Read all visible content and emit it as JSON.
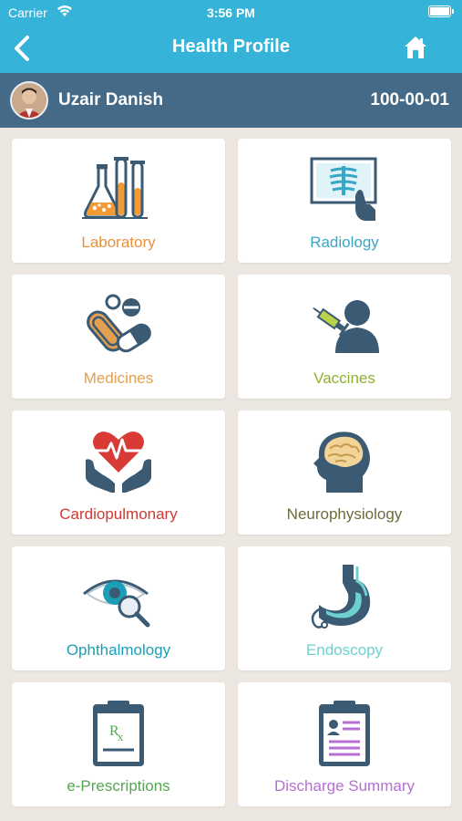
{
  "status_bar": {
    "carrier": "Carrier",
    "time": "3:56 PM"
  },
  "nav": {
    "title": "Health Profile",
    "back_icon": "chevron-left-icon",
    "home_icon": "home-icon"
  },
  "patient": {
    "name": "Uzair Danish",
    "id": "100-00-01"
  },
  "colors": {
    "header": "#36b3d8",
    "profile_bar": "#456a87",
    "background": "#ece8e1"
  },
  "categories": [
    {
      "label": "Laboratory",
      "color": "#e8913a",
      "icon": "lab-flasks-icon"
    },
    {
      "label": "Radiology",
      "color": "#3aa6c7",
      "icon": "xray-icon"
    },
    {
      "label": "Medicines",
      "color": "#e3a04f",
      "icon": "pills-icon"
    },
    {
      "label": "Vaccines",
      "color": "#8fb12e",
      "icon": "vaccine-icon"
    },
    {
      "label": "Cardiopulmonary",
      "color": "#d03a34",
      "icon": "heart-hands-icon"
    },
    {
      "label": "Neurophysiology",
      "color": "#6b6b3e",
      "icon": "brain-icon"
    },
    {
      "label": "Ophthalmology",
      "color": "#1a9fb6",
      "icon": "eye-magnifier-icon"
    },
    {
      "label": "Endoscopy",
      "color": "#6fd1cf",
      "icon": "stomach-icon"
    },
    {
      "label": "e-Prescriptions",
      "color": "#54a84f",
      "icon": "prescription-icon"
    },
    {
      "label": "Discharge Summary",
      "color": "#b56fd0",
      "icon": "discharge-summary-icon"
    }
  ]
}
